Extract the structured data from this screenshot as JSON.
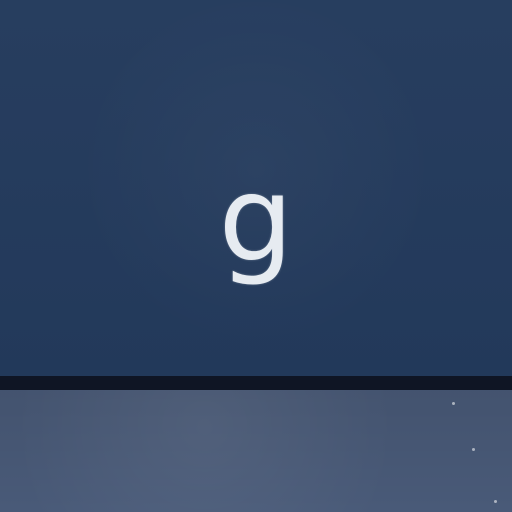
{
  "keyboard": {
    "key": {
      "legend": "g"
    }
  },
  "colors": {
    "keycap": "#233a5c",
    "legend": "#e6ebf1",
    "gap": "#0f1524",
    "lower_surface": "#495a78"
  }
}
